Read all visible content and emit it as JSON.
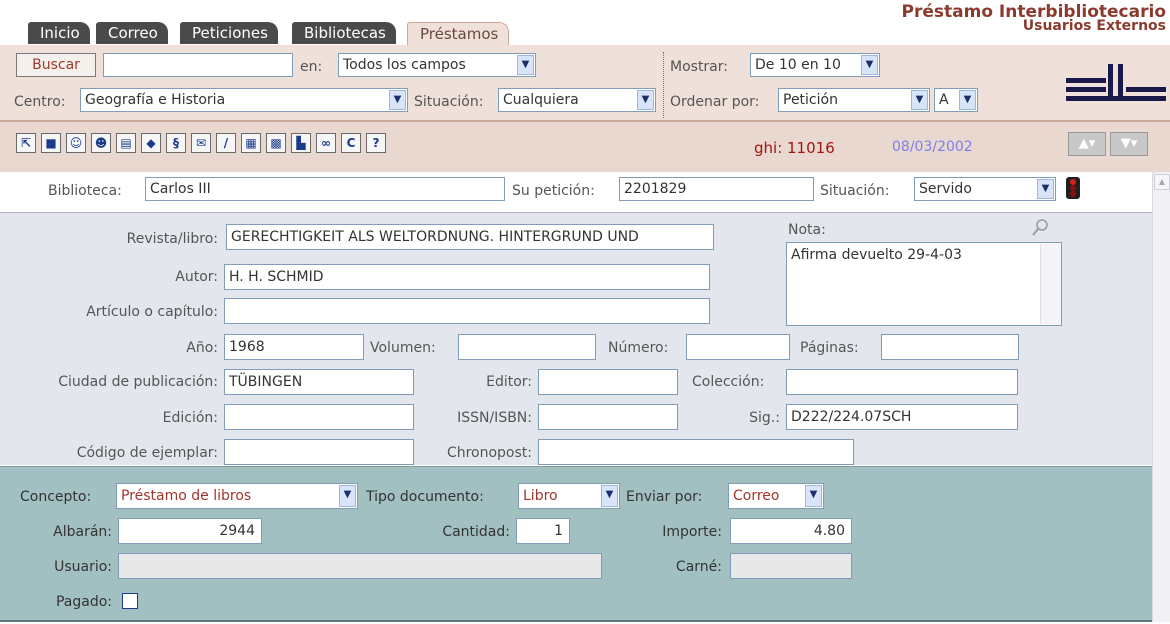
{
  "tabs": [
    {
      "label": "Inicio"
    },
    {
      "label": "Correo"
    },
    {
      "label": "Peticiones"
    },
    {
      "label": "Bibliotecas"
    },
    {
      "label": "Préstamos"
    }
  ],
  "header": {
    "title": "Préstamo Interbibliotecario",
    "subtitle": "Usuarios Externos"
  },
  "search": {
    "button": "Buscar",
    "value": "",
    "in_label": "en:",
    "in_value": "Todos los campos",
    "show_label": "Mostrar:",
    "show_value": "De 10 en 10",
    "center_label": "Centro:",
    "center_value": "Geografía e Historia",
    "status_label": "Situación:",
    "status_value": "Cualquiera",
    "order_label": "Ordenar por:",
    "order_value": "Petición",
    "order_dir": "A"
  },
  "toolbar": {
    "record_id": "ghi: 11016",
    "date": "08/03/2002",
    "icons": [
      "folder-up-icon",
      "save-icon",
      "search-users-icon",
      "users-icon",
      "print-icon",
      "tag-icon",
      "scroll-icon",
      "mail-icon",
      "pen-icon",
      "document-icon",
      "calendar-icon",
      "book-icon",
      "binoculars-icon",
      "return-icon",
      "help-icon"
    ]
  },
  "record": {
    "library_label": "Biblioteca:",
    "library": "Carlos III",
    "request_label": "Su petición:",
    "request": "2201829",
    "status_label": "Situación:",
    "status": "Servido"
  },
  "detail": {
    "journal_label": "Revista/libro:",
    "journal": "GERECHTIGKEIT ALS WELTORDNUNG. HINTERGRUND UND",
    "note_label": "Nota:",
    "note": "Afirma devuelto 29-4-03",
    "author_label": "Autor:",
    "author": "H. H. SCHMID",
    "article_label": "Artículo o capítulo:",
    "article": "",
    "year_label": "Año:",
    "year": "1968",
    "volume_label": "Volumen:",
    "volume": "",
    "number_label": "Número:",
    "number": "",
    "pages_label": "Páginas:",
    "pages": "",
    "city_label": "Ciudad de publicación:",
    "city": "TÜBINGEN",
    "publisher_label": "Editor:",
    "publisher": "",
    "collection_label": "Colección:",
    "collection": "",
    "edition_label": "Edición:",
    "edition": "",
    "issn_label": "ISSN/ISBN:",
    "issn": "",
    "sig_label": "Sig.:",
    "sig": "D222/224.07SCH",
    "copy_label": "Código de ejemplar:",
    "copy": "",
    "chrono_label": "Chronopost:",
    "chrono": ""
  },
  "billing": {
    "concept_label": "Concepto:",
    "concept": "Préstamo de libros",
    "doctype_label": "Tipo documento:",
    "doctype": "Libro",
    "send_label": "Enviar por:",
    "send": "Correo",
    "delivery_label": "Albarán:",
    "delivery": "2944",
    "qty_label": "Cantidad:",
    "qty": "1",
    "amount_label": "Importe:",
    "amount": "4.80",
    "user_label": "Usuario:",
    "user": "",
    "card_label": "Carné:",
    "card": "",
    "paid_label": "Pagado:"
  },
  "colors": {
    "tab_dark": "#4a4a4a",
    "band": "#efe0da",
    "detail_bg": "#e4e6ee",
    "billing_bg": "#a2bfc1",
    "accent_red": "#a3150f"
  }
}
